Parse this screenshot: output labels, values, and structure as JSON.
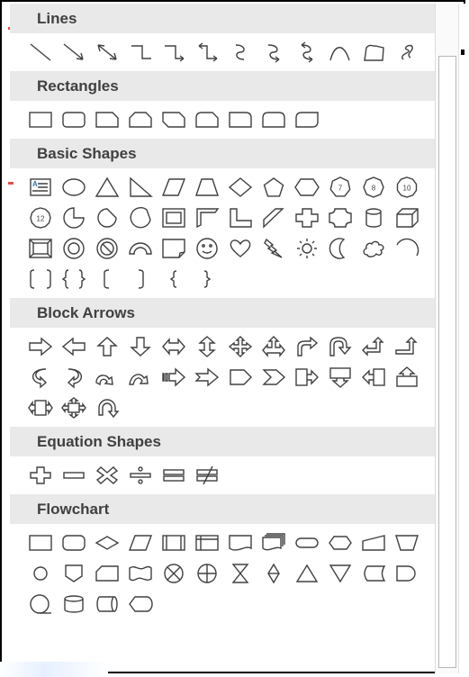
{
  "panel": {
    "sections": [
      {
        "title": "Lines",
        "rows": [
          [
            "line",
            "arrow-line",
            "double-arrow-line",
            "elbow-connector",
            "elbow-arrow-connector",
            "elbow-double-arrow-connector",
            "curved-connector",
            "curved-arrow-connector",
            "curved-double-arrow-connector",
            "curve",
            "freeform-shape",
            "freeform-scribble"
          ]
        ]
      },
      {
        "title": "Rectangles",
        "rows": [
          [
            "rectangle",
            "rounded-rectangle",
            "snip-single-corner-rectangle",
            "snip-same-side-corner-rectangle",
            "snip-diagonal-corner-rectangle",
            "snip-round-single-corner-rectangle",
            "round-single-corner-rectangle",
            "round-same-side-corner-rectangle",
            "round-diagonal-corner-rectangle"
          ]
        ]
      },
      {
        "title": "Basic Shapes",
        "rows": [
          [
            "text-box",
            "oval",
            "isosceles-triangle",
            "right-triangle",
            "parallelogram",
            "trapezoid",
            "diamond",
            "regular-pentagon",
            "hexagon",
            "heptagon",
            "octagon",
            "decagon"
          ],
          [
            "dodecagon",
            "pie",
            "teardrop",
            "chord",
            "frame",
            "half-frame",
            "l-shape",
            "diagonal-stripe",
            "cross",
            "plaque",
            "can",
            "cube"
          ],
          [
            "bevel",
            "donut",
            "no-symbol",
            "block-arc",
            "folded-corner",
            "smiley-face",
            "heart",
            "lightning-bolt",
            "sun",
            "moon",
            "cloud",
            "arc"
          ],
          [
            "double-bracket",
            "double-brace",
            "left-bracket",
            "right-bracket",
            "left-brace",
            "right-brace"
          ]
        ]
      },
      {
        "title": "Block Arrows",
        "rows": [
          [
            "right-arrow",
            "left-arrow",
            "up-arrow",
            "down-arrow",
            "left-right-arrow",
            "up-down-arrow",
            "quad-arrow",
            "left-right-up-arrow",
            "bent-arrow",
            "u-turn-arrow",
            "left-up-arrow",
            "bent-up-arrow"
          ],
          [
            "curved-right-arrow",
            "curved-left-arrow",
            "curved-up-arrow",
            "curved-down-arrow",
            "striped-right-arrow",
            "notched-right-arrow",
            "pentagon-arrow",
            "chevron",
            "right-arrow-callout",
            "down-arrow-callout",
            "left-arrow-callout",
            "up-arrow-callout"
          ],
          [
            "left-right-arrow-callout",
            "quad-arrow-callout",
            "circular-arrow"
          ]
        ]
      },
      {
        "title": "Equation Shapes",
        "rows": [
          [
            "plus",
            "minus",
            "multiply",
            "division",
            "equal",
            "not-equal"
          ]
        ]
      },
      {
        "title": "Flowchart",
        "rows": [
          [
            "flowchart-process",
            "flowchart-alternate-process",
            "flowchart-decision",
            "flowchart-data",
            "flowchart-predefined-process",
            "flowchart-internal-storage",
            "flowchart-document",
            "flowchart-multidocument",
            "flowchart-terminator",
            "flowchart-preparation",
            "flowchart-manual-input",
            "flowchart-manual-operation"
          ],
          [
            "flowchart-connector",
            "flowchart-off-page-connector",
            "flowchart-card",
            "flowchart-punched-tape",
            "flowchart-summing-junction",
            "flowchart-or",
            "flowchart-collate",
            "flowchart-sort",
            "flowchart-extract",
            "flowchart-merge",
            "flowchart-stored-data",
            "flowchart-delay"
          ],
          [
            "flowchart-sequential-access-storage",
            "flowchart-magnetic-disk",
            "flowchart-direct-access-storage",
            "flowchart-display"
          ]
        ]
      }
    ]
  },
  "colors": {
    "header_bg": "#e9e9e9",
    "header_text": "#404040",
    "icon_stroke": "#404040",
    "icon_text_box_fill": "#2e75b6"
  }
}
